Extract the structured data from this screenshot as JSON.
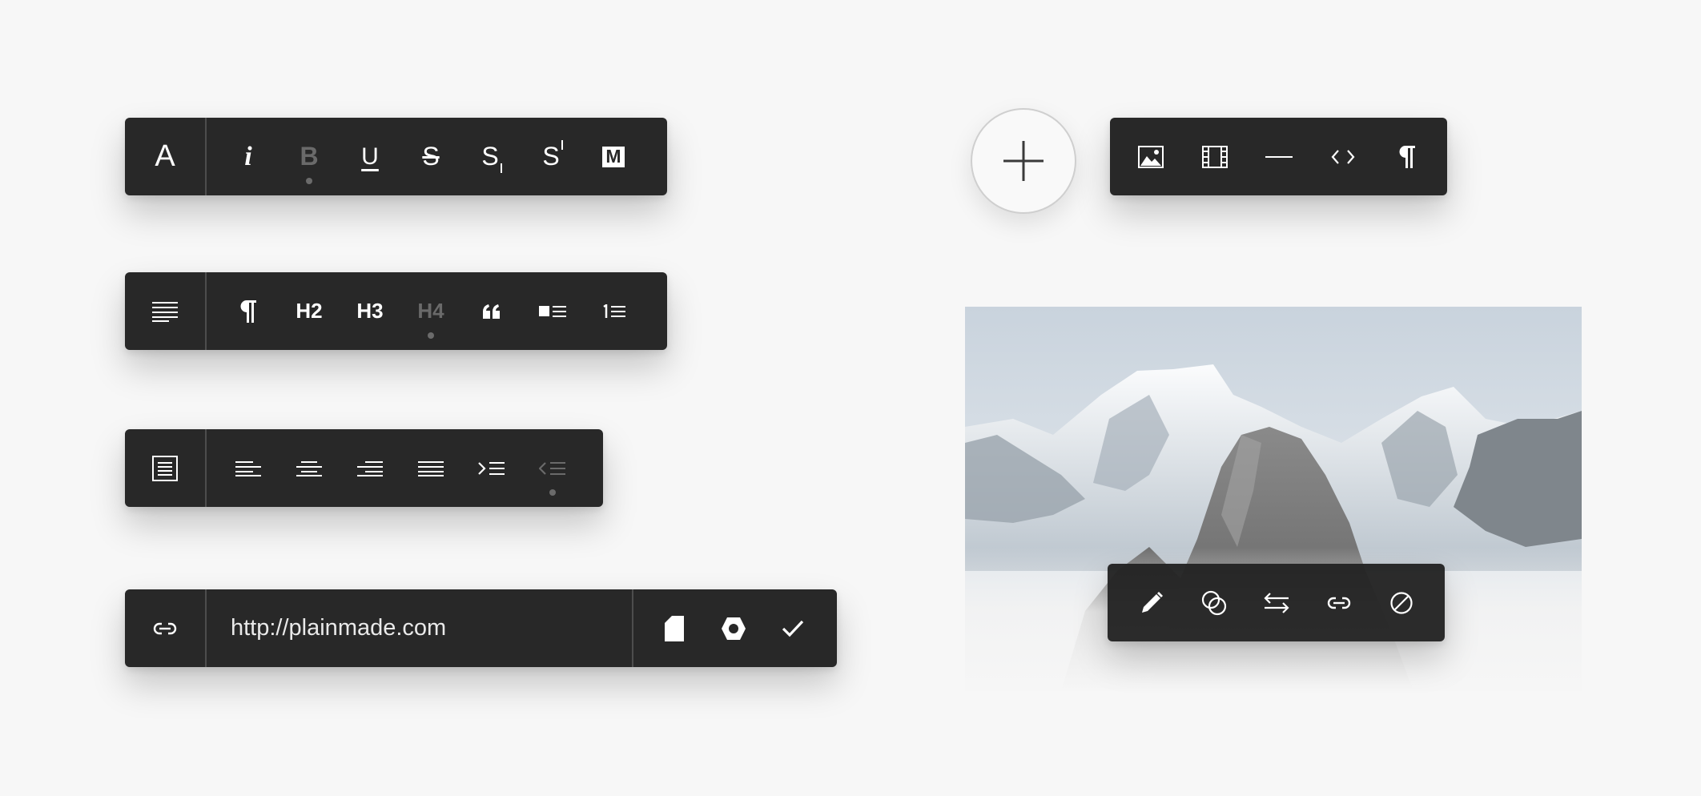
{
  "formatting_toolbar": {
    "lead": "A",
    "items": [
      {
        "icon": "italic-icon",
        "text": "i",
        "active": false
      },
      {
        "icon": "bold-icon",
        "text": "B",
        "active": true
      },
      {
        "icon": "underline-icon",
        "text": "U",
        "active": false
      },
      {
        "icon": "strikethrough-icon",
        "text": "S",
        "active": false
      },
      {
        "icon": "subscript-icon",
        "text": "S",
        "active": false
      },
      {
        "icon": "superscript-icon",
        "text": "S",
        "active": false
      },
      {
        "icon": "monospace-icon",
        "text": "M",
        "active": false
      }
    ]
  },
  "block_toolbar": {
    "lead_icon": "text-block-icon",
    "h2": "H2",
    "h3": "H3",
    "h4": "H4",
    "active": "H4",
    "items": [
      "paragraph-icon",
      "h2",
      "h3",
      "h4",
      "quote-icon",
      "bulleted-list-icon",
      "numbered-list-icon"
    ]
  },
  "alignment_toolbar": {
    "lead_icon": "document-icon",
    "items": [
      "align-left-icon",
      "align-center-icon",
      "align-right-icon",
      "justify-icon",
      "indent-icon",
      "outdent-icon"
    ],
    "disabled": "outdent-icon"
  },
  "link_toolbar": {
    "lead_icon": "link-icon",
    "url": "http://plainmade.com",
    "items": [
      "page-icon",
      "hexagon-icon",
      "check-icon"
    ]
  },
  "insert_menu": {
    "trigger_icon": "plus-icon",
    "items": [
      "image-icon",
      "video-icon",
      "divider-icon",
      "code-icon",
      "paragraph-icon"
    ]
  },
  "image_toolbar": {
    "items": [
      "pencil-icon",
      "blend-icon",
      "swap-icon",
      "link-icon",
      "remove-icon"
    ]
  },
  "colors": {
    "toolbar_bg": "#282828",
    "icon": "#ffffff",
    "inactive_icon": "#6a6a6a",
    "page_bg": "#f7f7f7"
  }
}
